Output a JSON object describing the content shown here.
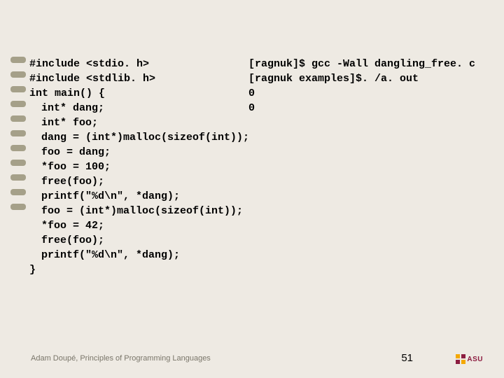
{
  "code": {
    "lines": [
      {
        "text": "#include <stdio. h>",
        "indent": false,
        "bullet": false
      },
      {
        "text": "#include <stdlib. h>",
        "indent": false,
        "bullet": false
      },
      {
        "text": "int main() {",
        "indent": false,
        "bullet": false
      },
      {
        "text": "int* dang;",
        "indent": true,
        "bullet": true
      },
      {
        "text": "int* foo;",
        "indent": true,
        "bullet": true
      },
      {
        "text": "dang = (int*)malloc(sizeof(int));",
        "indent": true,
        "bullet": true
      },
      {
        "text": "foo = dang;",
        "indent": true,
        "bullet": true
      },
      {
        "text": "*foo = 100;",
        "indent": true,
        "bullet": true
      },
      {
        "text": "free(foo);",
        "indent": true,
        "bullet": true
      },
      {
        "text": "printf(\"%d\\n\", *dang);",
        "indent": true,
        "bullet": true
      },
      {
        "text": "foo = (int*)malloc(sizeof(int));",
        "indent": true,
        "bullet": true
      },
      {
        "text": "*foo = 42;",
        "indent": true,
        "bullet": true
      },
      {
        "text": "free(foo);",
        "indent": true,
        "bullet": true
      },
      {
        "text": "printf(\"%d\\n\", *dang);",
        "indent": true,
        "bullet": true
      },
      {
        "text": "}",
        "indent": false,
        "bullet": false
      }
    ]
  },
  "terminal": {
    "lines": [
      "[ragnuk]$ gcc -Wall dangling_free. c",
      "[ragnuk examples]$. /a. out",
      "0",
      "0"
    ]
  },
  "footer": "Adam Doupé, Principles of Programming Languages",
  "page_number": "51",
  "logo_text": "ASU"
}
